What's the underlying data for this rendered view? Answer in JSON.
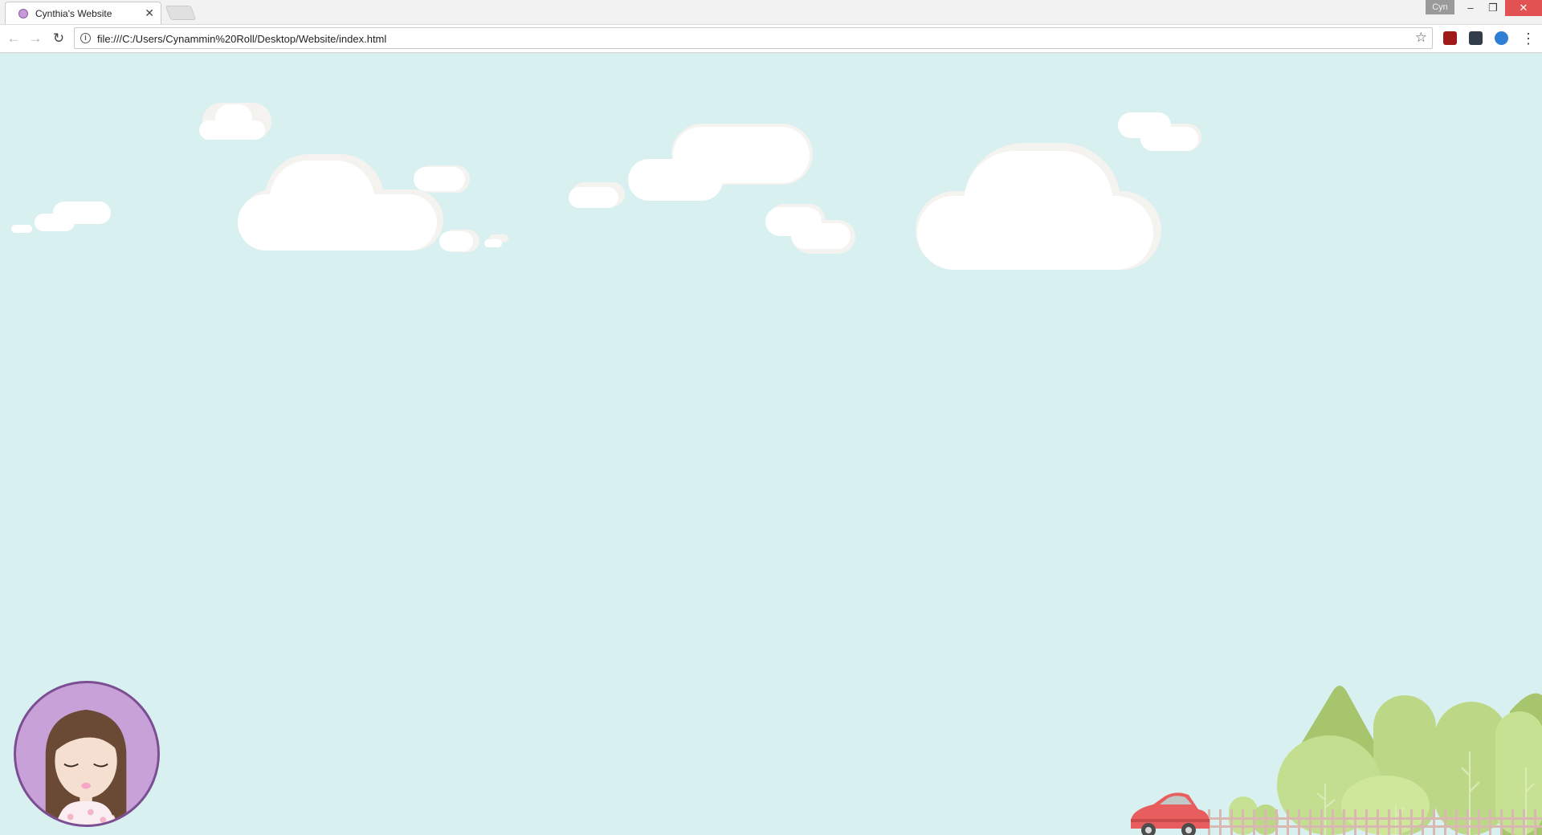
{
  "browser": {
    "tab_title": "Cynthia's Website",
    "tab_close": "✕",
    "user_badge": "Cyn",
    "url": "file:///C:/Users/Cynammin%20Roll/Desktop/Website/index.html",
    "nav": {
      "back": "←",
      "forward": "→",
      "reload": "↻"
    },
    "window_controls": {
      "minimize": "–",
      "restore": "❐",
      "close": "✕"
    },
    "bookmark_star": "☆",
    "menu": "⋮",
    "extensions": [
      "ublock-icon",
      "extension-icon",
      "sync-icon"
    ]
  },
  "page": {
    "background_color": "#d9f0f1",
    "avatar_bg": "#c9a1d9",
    "avatar_border": "#7b4e93",
    "car_color": "#e85d5d"
  }
}
